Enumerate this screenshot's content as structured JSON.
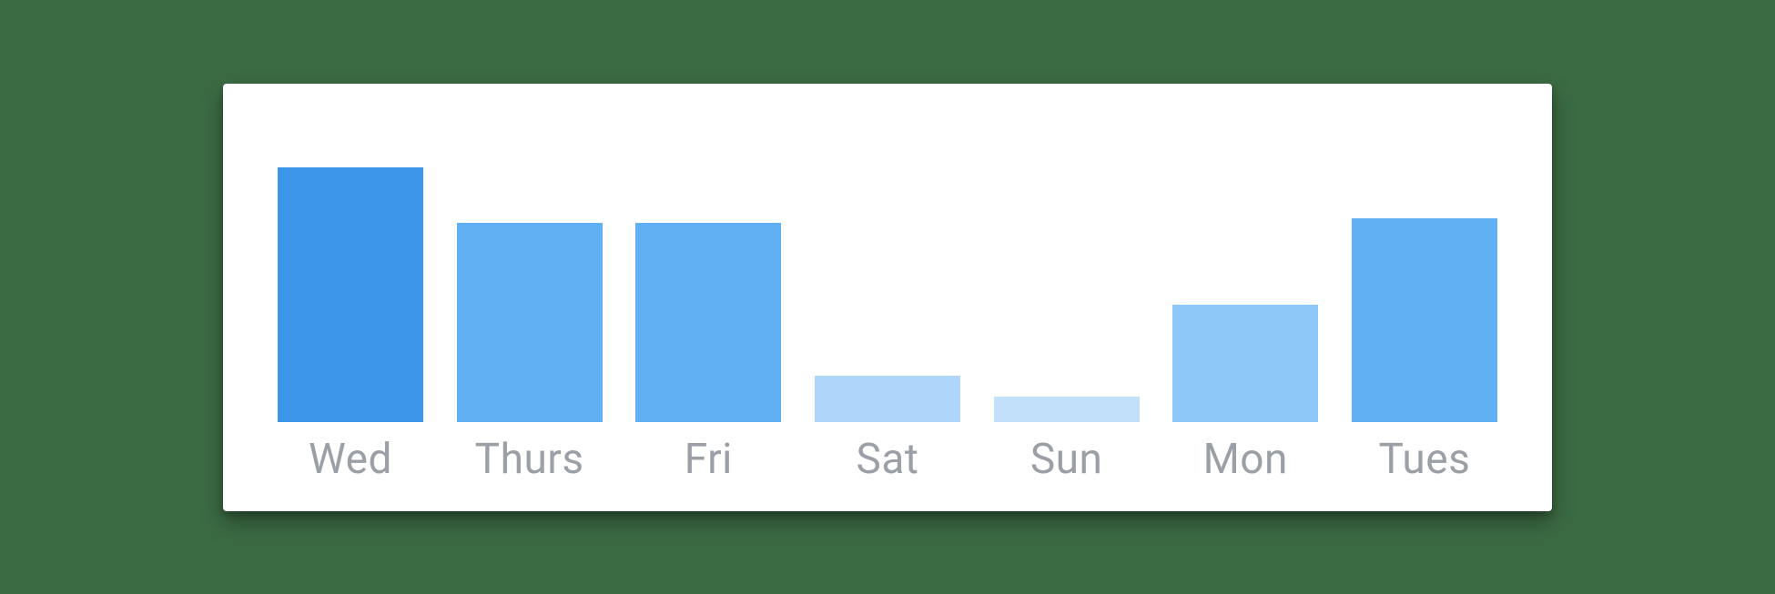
{
  "chart_data": {
    "type": "bar",
    "categories": [
      "Wed",
      "Thurs",
      "Fri",
      "Sat",
      "Sun",
      "Mon",
      "Tues"
    ],
    "values": [
      100,
      78,
      78,
      18,
      10,
      46,
      80
    ],
    "colors": [
      "#3c95e8",
      "#62b0f4",
      "#62b0f4",
      "#aed6fb",
      "#c3e0fb",
      "#8ec8f8",
      "#62b0f4"
    ],
    "title": "",
    "xlabel": "",
    "ylabel": "",
    "ylim": [
      0,
      100
    ]
  }
}
